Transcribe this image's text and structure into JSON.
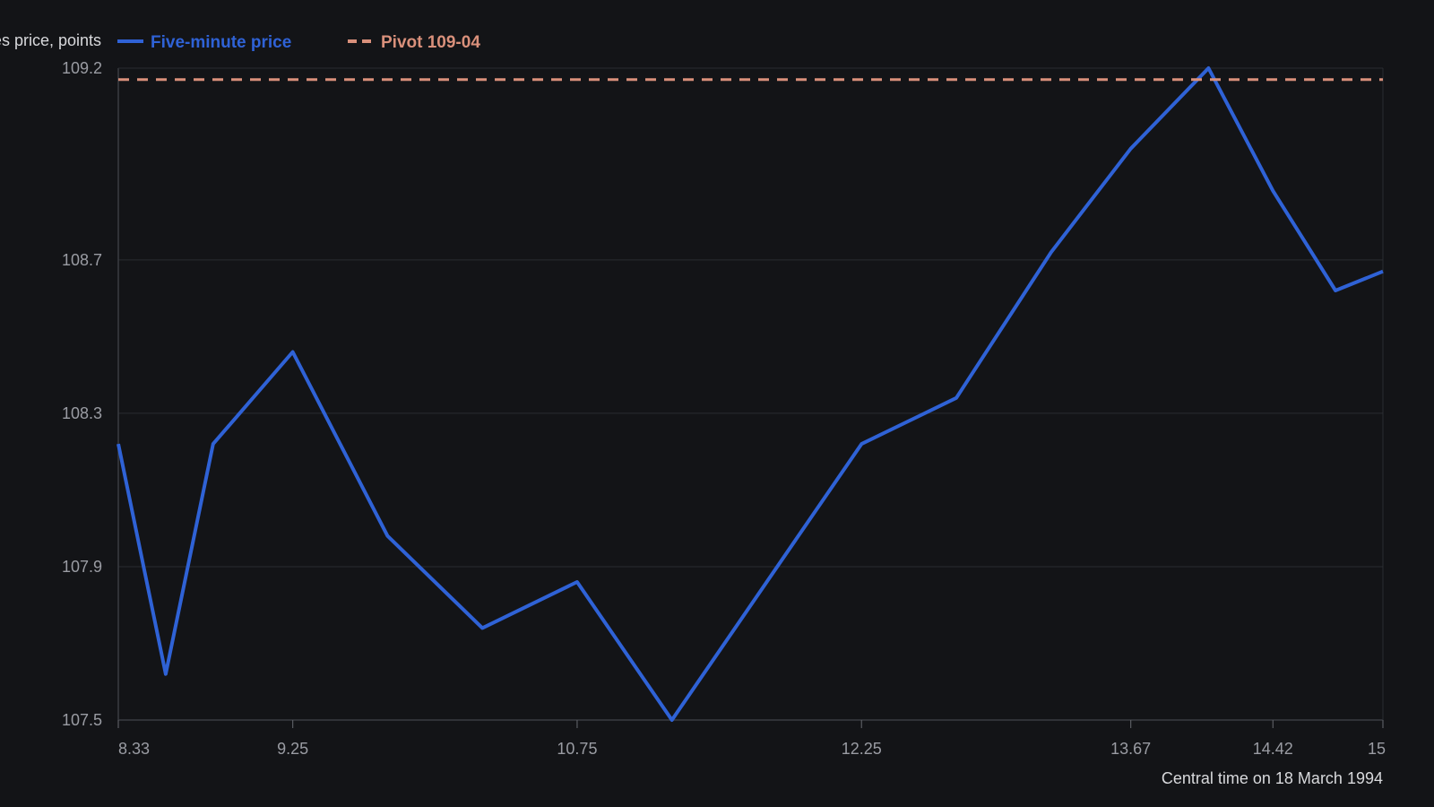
{
  "chart_data": {
    "type": "line",
    "ylabel": "Futures price, points",
    "xlabel": "Central time on 18 March 1994",
    "xlim": [
      8.33,
      15
    ],
    "ylim": [
      107.5,
      109.2
    ],
    "x_ticks": [
      8.33,
      9.25,
      10.75,
      12.25,
      13.67,
      14.42,
      15
    ],
    "x_tick_labels": [
      "8.33",
      "9.25",
      "10.75",
      "12.25",
      "13.67",
      "14.42",
      "15"
    ],
    "y_ticks": [
      107.5,
      107.9,
      108.3,
      108.7,
      109.2
    ],
    "y_tick_labels": [
      "107.5",
      "107.9",
      "108.3",
      "108.7",
      "109.2"
    ],
    "grid": true,
    "legend_position": "top-left",
    "series": [
      {
        "name": "Five-minute price",
        "style": "solid",
        "color": "#2f62d6",
        "x": [
          8.33,
          8.58,
          8.83,
          9.25,
          9.75,
          10.25,
          10.75,
          11.25,
          11.75,
          12.25,
          12.75,
          13.25,
          13.67,
          14.08,
          14.42,
          14.75,
          15
        ],
        "y": [
          108.22,
          107.62,
          108.22,
          108.46,
          107.98,
          107.74,
          107.86,
          107.5,
          107.86,
          108.22,
          108.34,
          108.72,
          108.99,
          109.2,
          108.88,
          108.62,
          108.67
        ]
      },
      {
        "name": "Pivot 109-04",
        "style": "dashed",
        "color": "#d9907b",
        "x": [
          8.33,
          15
        ],
        "y": [
          109.17,
          109.17
        ]
      }
    ]
  }
}
